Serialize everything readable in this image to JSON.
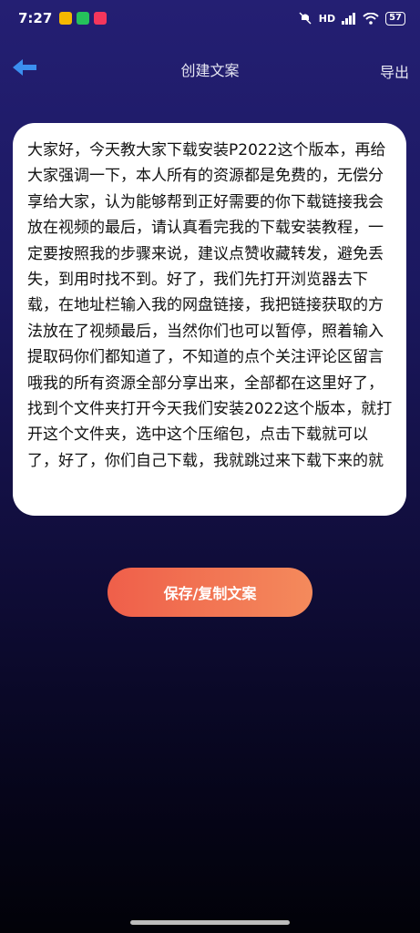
{
  "status_bar": {
    "time": "7:27",
    "network": "HD",
    "battery": "57",
    "app_badges": [
      "#f5b800",
      "#25c25b",
      "#f5365c"
    ]
  },
  "header": {
    "back_icon": "arrow-left-icon",
    "title": "创建文案",
    "export_label": "导出"
  },
  "editor": {
    "text": "大家好，今天教大家下载安装P2022这个版本，再给大家强调一下，本人所有的资源都是免费的，无偿分享给大家，认为能够帮到正好需要的你下载链接我会放在视频的最后，请认真看完我的下载安装教程，一定要按照我的步骤来说，建议点赞收藏转发，避免丢失，到用时找不到。好了，我们先打开浏览器去下载，在地址栏输入我的网盘链接，我把链接获取的方法放在了视频最后，当然你们也可以暂停，照着输入提取码你们都知道了，不知道的点个关注评论区留言哦我的所有资源全部分享出来，全部都在这里好了，找到个文件夹打开今天我们安装2022这个版本，就打开这个文件夹，选中这个压缩包，点击下载就可以了，好了，你们自己下载，我就跳过来下载下来的就"
  },
  "actions": {
    "save_label": "保存/复制文案"
  },
  "colors": {
    "back_arrow": "#3b8ff0",
    "button_start": "#ef5f4a",
    "button_end": "#f48a5c"
  }
}
